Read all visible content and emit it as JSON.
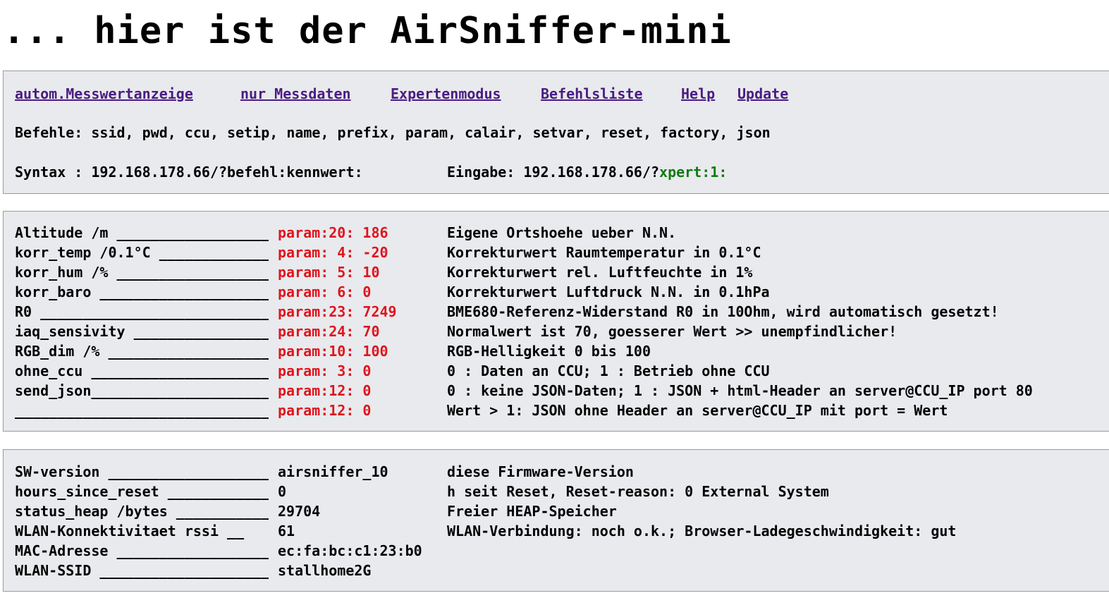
{
  "header": {
    "title": "... hier ist der AirSniffer-mini"
  },
  "nav": {
    "links": [
      {
        "label": "autom.Messwertanzeige"
      },
      {
        "label": "nur Messdaten"
      },
      {
        "label": "Expertenmodus"
      },
      {
        "label": "Befehlsliste"
      },
      {
        "label": "Help"
      },
      {
        "label": "Update"
      }
    ],
    "commands_line": "Befehle: ssid, pwd, ccu, setip, name, prefix, param, calair, setvar, reset, factory, json",
    "syntax_line": "Syntax : 192.168.178.66/?befehl:kennwert:",
    "input_prefix": "Eingabe: 192.168.178.66/?",
    "input_value": "xpert:1:"
  },
  "params": {
    "rows": [
      {
        "label": "Altitude /m ____________________",
        "value": "param:20: 186",
        "description": "Eigene Ortshoehe ueber N.N."
      },
      {
        "label": "korr_temp /0.1°C ________________",
        "value": "param: 4: -20",
        "description": "Korrekturwert Raumtemperatur in 0.1°C"
      },
      {
        "label": "korr_hum /% _____________________",
        "value": "param: 5: 10",
        "description": "Korrekturwert rel. Luftfeuchte in 1%"
      },
      {
        "label": "korr_baro ________________________",
        "value": "param: 6: 0",
        "description": "Korrekturwert Luftdruck N.N. in 0.1hPa"
      },
      {
        "label": "R0 _________________________________",
        "value": "param:23: 7249",
        "description": "BME680-Referenz-Widerstand R0 in 10Ohm, wird automatisch gesetzt!"
      },
      {
        "label": "iaq_sensivity ____________________",
        "value": "param:24: 70",
        "description": "Normalwert ist 70, goesserer Wert >> unempfindlicher!"
      },
      {
        "label": "RGB_dim /% _______________________",
        "value": "param:10: 100",
        "description": "RGB-Helligkeit 0 bis 100"
      },
      {
        "label": "ohne_ccu __________________________",
        "value": "param: 3: 0",
        "description": "0 : Daten an CCU; 1 : Betrieb ohne CCU"
      },
      {
        "label": "send_json__________________________",
        "value": "param:12: 0",
        "description": "0 : keine JSON-Daten; 1 : JSON + html-Header an server@CCU_IP port 80"
      },
      {
        "label": "___________________________________",
        "value": "param:12: 0",
        "description": "Wert > 1: JSON ohne Header an server@CCU_IP mit port = Wert"
      }
    ]
  },
  "status": {
    "rows": [
      {
        "label": "SW-version ________________________",
        "value": "airsniffer_10",
        "description": "diese Firmware-Version"
      },
      {
        "label": "hours_since_reset __________________",
        "value": "0",
        "description": "h seit Reset, Reset-reason: 0 External System"
      },
      {
        "label": "status_heap /bytes __________________",
        "value": "29704",
        "description": "Freier HEAP-Speicher"
      },
      {
        "label": "WLAN-Konnektivitaet rssi __",
        "value": "61",
        "description": "WLAN-Verbindung: noch o.k.; Browser-Ladegeschwindigkeit: gut"
      },
      {
        "label": "MAC-Adresse ________________________",
        "value": "ec:fa:bc:c1:23:b0",
        "description": ""
      },
      {
        "label": "WLAN-SSID __________________________",
        "value": "stallhome2G",
        "description": ""
      }
    ]
  },
  "colors": {
    "param_value": "#e0141e",
    "link": "#4b1c83",
    "highlight": "#137a13",
    "panel_bg": "#e8eaed"
  }
}
